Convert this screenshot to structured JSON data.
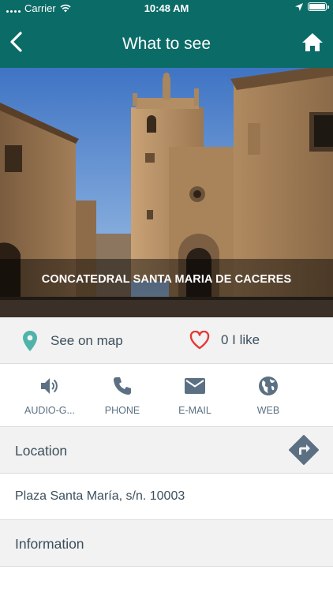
{
  "status_bar": {
    "carrier": "Carrier",
    "time": "10:48 AM"
  },
  "nav": {
    "title": "What to see",
    "back_icon": "chevron-left-icon",
    "home_icon": "home-icon"
  },
  "hero": {
    "caption": "CONCATEDRAL SANTA MARIA DE CACERES"
  },
  "quick_row": {
    "map_label": "See on map",
    "likes_label": "0 I like",
    "map_icon_color": "#4fb3a9",
    "heart_color": "#e53935"
  },
  "actions": [
    {
      "label": "AUDIO-G...",
      "icon": "speaker-icon"
    },
    {
      "label": "PHONE",
      "icon": "phone-icon"
    },
    {
      "label": "E-MAIL",
      "icon": "email-icon"
    },
    {
      "label": "WEB",
      "icon": "globe-icon"
    }
  ],
  "location": {
    "title": "Location",
    "address": "Plaza Santa María, s/n. 10003",
    "route_icon": "directions-icon"
  },
  "information": {
    "title": "Information"
  },
  "colors": {
    "header": "#0b6b67",
    "icon": "#5b7082",
    "section_bg": "#f2f2f2"
  }
}
